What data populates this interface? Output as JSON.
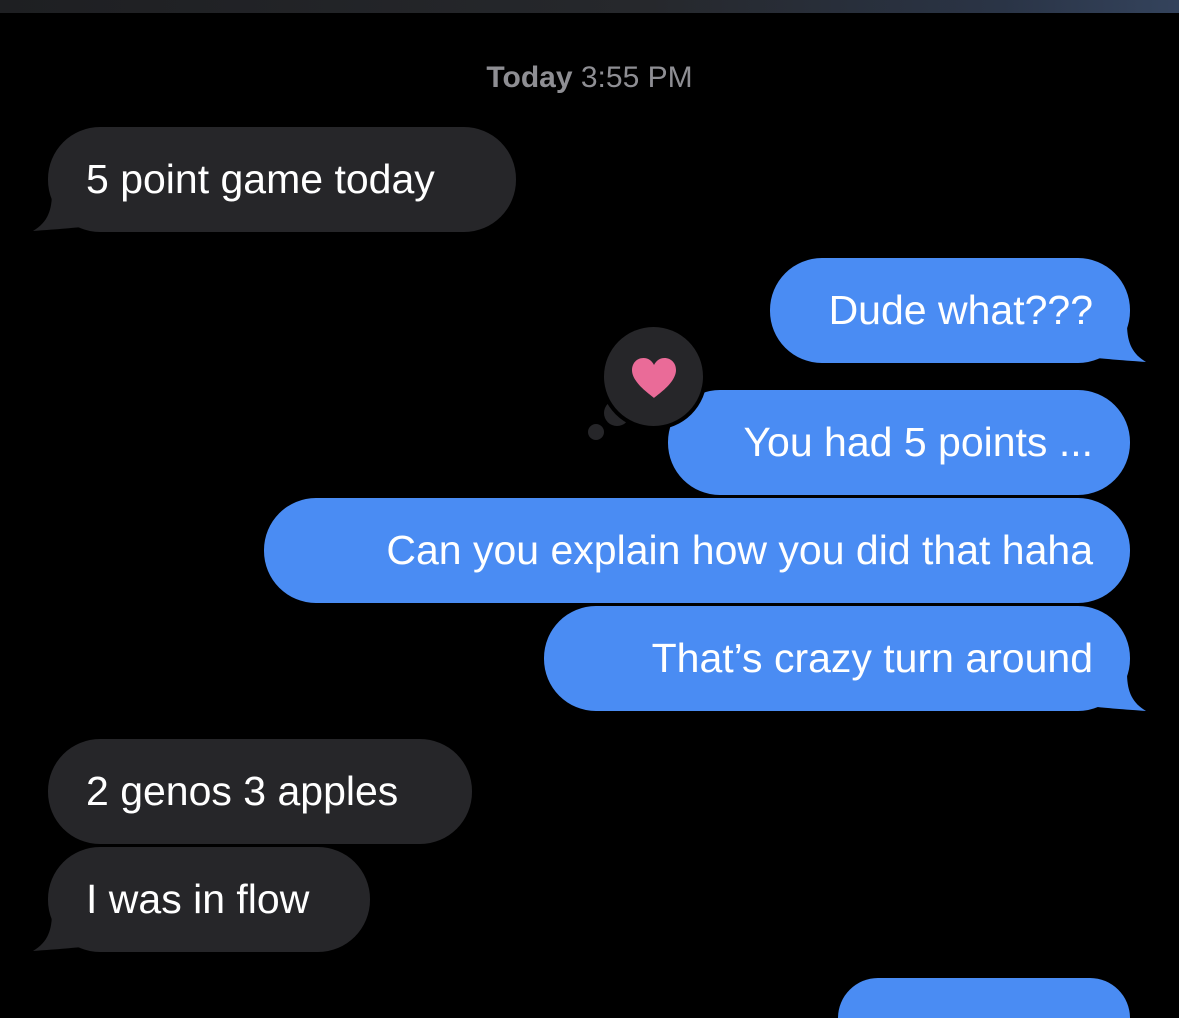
{
  "timestamp": {
    "day": "Today",
    "time": "3:55 PM"
  },
  "messages": [
    {
      "direction": "received",
      "text": "5 point game today"
    },
    {
      "direction": "sent",
      "text": "Dude what???"
    },
    {
      "direction": "sent",
      "text": "You had 5 points ...",
      "reaction": "heart-icon"
    },
    {
      "direction": "sent",
      "text": "Can you explain how you did that haha"
    },
    {
      "direction": "sent",
      "text": "That’s crazy turn around"
    },
    {
      "direction": "received",
      "text": "2 genos 3 apples"
    },
    {
      "direction": "received",
      "text": "I was in flow"
    }
  ],
  "colors": {
    "background": "#000000",
    "sent_bubble": "#4a8cf3",
    "received_bubble": "#262629",
    "timestamp_text": "#8e8e93",
    "heart": "#ea6b98"
  }
}
